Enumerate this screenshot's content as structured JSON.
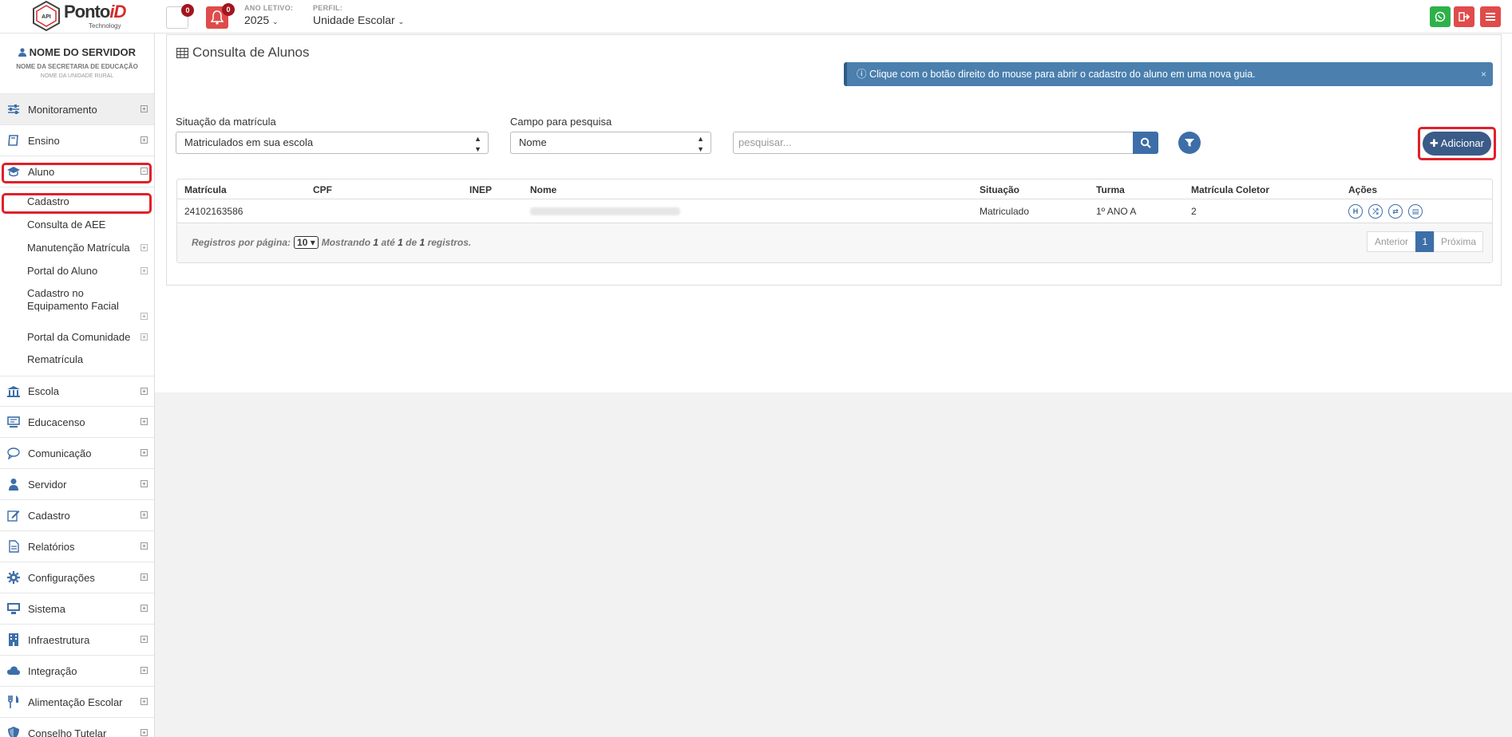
{
  "header": {
    "brand_main": "Ponto",
    "brand_accent": "iD",
    "brand_sub": "Technology",
    "logo_badge": "API",
    "messages_count": "0",
    "alerts_count": "0",
    "year_label": "ANO LETIVO:",
    "year_value": "2025",
    "perfil_label": "PERFIL:",
    "perfil_value": "Unidade Escolar"
  },
  "user": {
    "name": "NOME DO SERVIDOR",
    "secretaria": "NOME DA SECRETARIA DE EDUCAÇÃO",
    "unidade": "NOME DA UNIDADE RURAL"
  },
  "sidebar": {
    "items": [
      {
        "label": "Monitoramento"
      },
      {
        "label": "Ensino"
      },
      {
        "label": "Aluno"
      },
      {
        "label": "Escola"
      },
      {
        "label": "Educacenso"
      },
      {
        "label": "Comunicação"
      },
      {
        "label": "Servidor"
      },
      {
        "label": "Cadastro"
      },
      {
        "label": "Relatórios"
      },
      {
        "label": "Configurações"
      },
      {
        "label": "Sistema"
      },
      {
        "label": "Infraestrutura"
      },
      {
        "label": "Integração"
      },
      {
        "label": "Alimentação Escolar"
      },
      {
        "label": "Conselho Tutelar"
      }
    ],
    "aluno_sub": [
      {
        "label": "Cadastro"
      },
      {
        "label": "Consulta de AEE"
      },
      {
        "label": "Manutenção Matrícula"
      },
      {
        "label": "Portal do Aluno"
      },
      {
        "label": "Cadastro no Equipamento Facial"
      },
      {
        "label": "Portal da Comunidade"
      },
      {
        "label": "Rematrícula"
      }
    ]
  },
  "main": {
    "title": "Consulta de Alunos",
    "alert": "Clique com o botão direito do mouse para abrir o cadastro do aluno em uma nova guia.",
    "alert_close": "×",
    "situacao_label": "Situação da matrícula",
    "situacao_value": "Matriculados em sua escola",
    "campo_label": "Campo para pesquisa",
    "campo_value": "Nome",
    "search_placeholder": "pesquisar...",
    "add_label": "Adicionar"
  },
  "table": {
    "headers": [
      "Matrícula",
      "CPF",
      "INEP",
      "Nome",
      "Situação",
      "Turma",
      "Matrícula Coletor",
      "Ações"
    ],
    "rows": [
      {
        "matricula": "24102163586",
        "cpf": "",
        "inep": "",
        "situacao": "Matriculado",
        "turma": "1º ANO A",
        "coletor": "2"
      }
    ],
    "actions": [
      "H",
      "⤮",
      "⇄",
      "▤"
    ]
  },
  "pager": {
    "per_page_label": "Registros por página:",
    "per_page_value": "10",
    "showing": "Mostrando",
    "from": "1",
    "ate": "até",
    "to": "1",
    "de": "de",
    "total": "1",
    "registros": "registros.",
    "prev": "Anterior",
    "current": "1",
    "next": "Próxima"
  },
  "colors": {
    "primary": "#3d6ea8",
    "danger": "#e04b4b",
    "whatsapp": "#2fb14a",
    "highlight": "#e0202a"
  }
}
